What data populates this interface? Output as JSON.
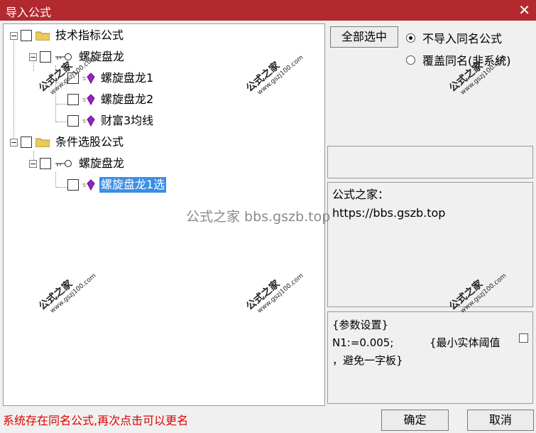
{
  "window": {
    "title": "导入公式",
    "close_glyph": "✕"
  },
  "tree": {
    "expander_glyph": "−",
    "nodes": [
      {
        "label": "技术指标公式",
        "icon": "folder-icon"
      },
      {
        "label": "螺旋盘龙",
        "icon": "key-icon"
      },
      {
        "label": "螺旋盘龙1",
        "icon": "gem-icon"
      },
      {
        "label": "螺旋盘龙2",
        "icon": "gem-icon"
      },
      {
        "label": "财富3均线",
        "icon": "gem-icon"
      },
      {
        "label": "条件选股公式",
        "icon": "folder-icon"
      },
      {
        "label": "螺旋盘龙",
        "icon": "key-icon"
      },
      {
        "label": "螺旋盘龙1选",
        "icon": "gem-icon",
        "selected": true
      }
    ]
  },
  "right": {
    "select_all_label": "全部选中",
    "radio_options": [
      {
        "label": "不导入同名公式",
        "checked": true
      },
      {
        "label": "覆盖同名(非系统)",
        "checked": false
      }
    ],
    "info_lines": [
      "公式之家：",
      "https://bbs.gszb.top"
    ],
    "params": {
      "line1": "{参数设置}",
      "line2_code": "N1:=0.005;",
      "line2_comment": "{最小实体阈值",
      "line3": "，避免一字板}"
    }
  },
  "footer": {
    "status": "系统存在同名公式,再次点击可以更名",
    "ok_label": "确定",
    "cancel_label": "取消"
  },
  "watermarks": {
    "stamp_text": "公式之家",
    "stamp_url": "www.gszj100.com",
    "center": "公式之家 bbs.gszb.top"
  },
  "colors": {
    "titlebar": "#b22a2f",
    "selection": "#3a8ee6",
    "status": "#e00000",
    "gem": "#9b1fc7"
  }
}
